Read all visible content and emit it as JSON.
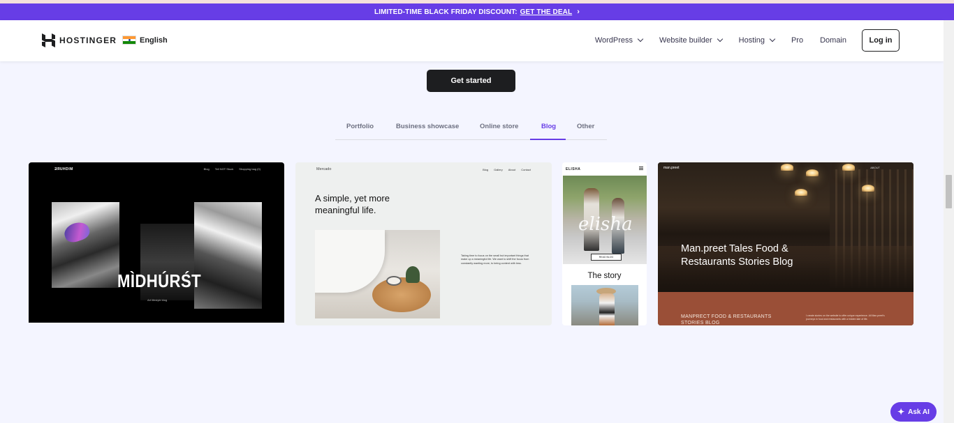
{
  "promo": {
    "text": "LIMITED-TIME BLACK FRIDAY DISCOUNT:",
    "link": "GET THE DEAL",
    "chevron": "›"
  },
  "header": {
    "brand": "HOSTINGER",
    "language": "English",
    "nav": [
      {
        "label": "WordPress",
        "has_dropdown": true
      },
      {
        "label": "Website builder",
        "has_dropdown": true
      },
      {
        "label": "Hosting",
        "has_dropdown": true
      },
      {
        "label": "Pro",
        "has_dropdown": false
      },
      {
        "label": "Domain",
        "has_dropdown": false
      }
    ],
    "login_label": "Log in"
  },
  "cta": {
    "get_started": "Get started"
  },
  "tabs": {
    "items": [
      "Portfolio",
      "Business showcase",
      "Online store",
      "Blog",
      "Other"
    ],
    "active": "Blog"
  },
  "templates": [
    {
      "brand": "ƎЯUHDIM",
      "menu": [
        "Blog",
        "Tell NOT Stuck",
        "Shopping bag (0)"
      ],
      "title": "MÌDHÚRŚT",
      "subtitle": "Art lifestyle blog"
    },
    {
      "brand": "Mercado",
      "menu": [
        "Blog",
        "Gallery",
        "About",
        "Contact"
      ],
      "headline": "A simple, yet more meaningful life.",
      "paragraph": "Taking time to focus on the small but important things that make up a meaningful life. We want to shift the focus from constantly wanting more, to being content with less."
    },
    {
      "brand": "ELISHA",
      "hero_script": "elisha",
      "button": "READ BLOG",
      "story": "The story"
    },
    {
      "brand": "man.preet",
      "menu": "ABOUT",
      "title": "Man.preet Tales Food & Restaurants Stories Blog",
      "band_title": "MANPRECT FOOD & RESTAURANTS STORIES BLOG",
      "band_text": "I create stories on the website to offer unique experience. All Man.preet's journeys in food and restaurants with a hidden tale of life."
    }
  ],
  "assistant": {
    "label": "Ask AI"
  },
  "colors": {
    "accent": "#673de6",
    "dark": "#1d1e20",
    "background": "#f4f5ff",
    "band": "#9a4f37"
  }
}
